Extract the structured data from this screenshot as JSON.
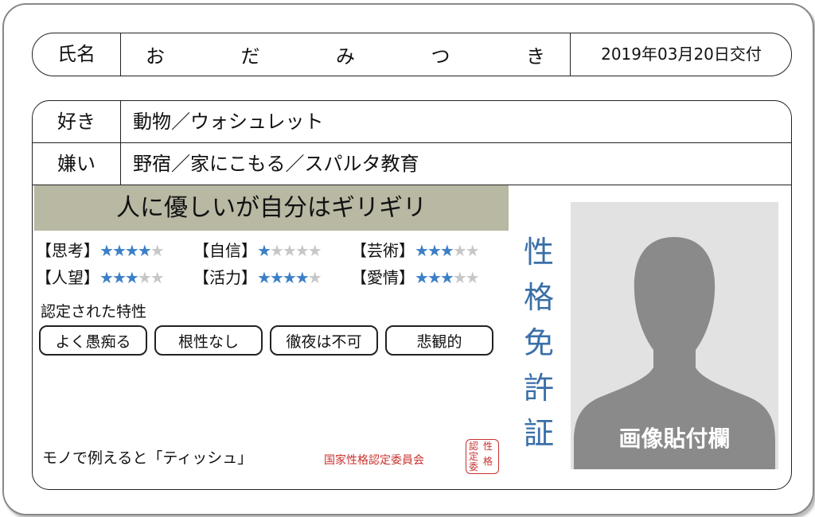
{
  "name": {
    "label": "氏名",
    "chars": [
      "お",
      "だ",
      "み",
      "つ",
      "き"
    ],
    "issued": "2019年03月20日交付"
  },
  "likes": {
    "label": "好き",
    "value": "動物／ウォシュレット"
  },
  "dislikes": {
    "label": "嫌い",
    "value": "野宿／家にこもる／スパルタ教育"
  },
  "banner": "人に優しいが自分はギリギリ",
  "skills": [
    {
      "label": "【思考】",
      "level": 4,
      "max": 5
    },
    {
      "label": "【自信】",
      "level": 1,
      "max": 5
    },
    {
      "label": "【芸術】",
      "level": 3,
      "max": 5
    },
    {
      "label": "【人望】",
      "level": 3,
      "max": 5
    },
    {
      "label": "【活力】",
      "level": 4,
      "max": 5
    },
    {
      "label": "【愛情】",
      "level": 3,
      "max": 5
    }
  ],
  "traits": {
    "label": "認定された特性",
    "items": [
      "よく愚痴る",
      "根性なし",
      "徹夜は不可",
      "悲観的"
    ]
  },
  "license_title": "性格免許証",
  "photo_label": "画像貼付欄",
  "example": "モノで例えると「ティッシュ」",
  "issuer": "国家性格認定委員会",
  "seal_chars": [
    "認",
    "性",
    "定",
    "格",
    "委"
  ],
  "colors": {
    "star_on": "#3b7fc7",
    "star_off": "#c7c7c7",
    "title": "#3a6fa8",
    "seal": "#c8322f",
    "banner": "#b8b8a3"
  }
}
